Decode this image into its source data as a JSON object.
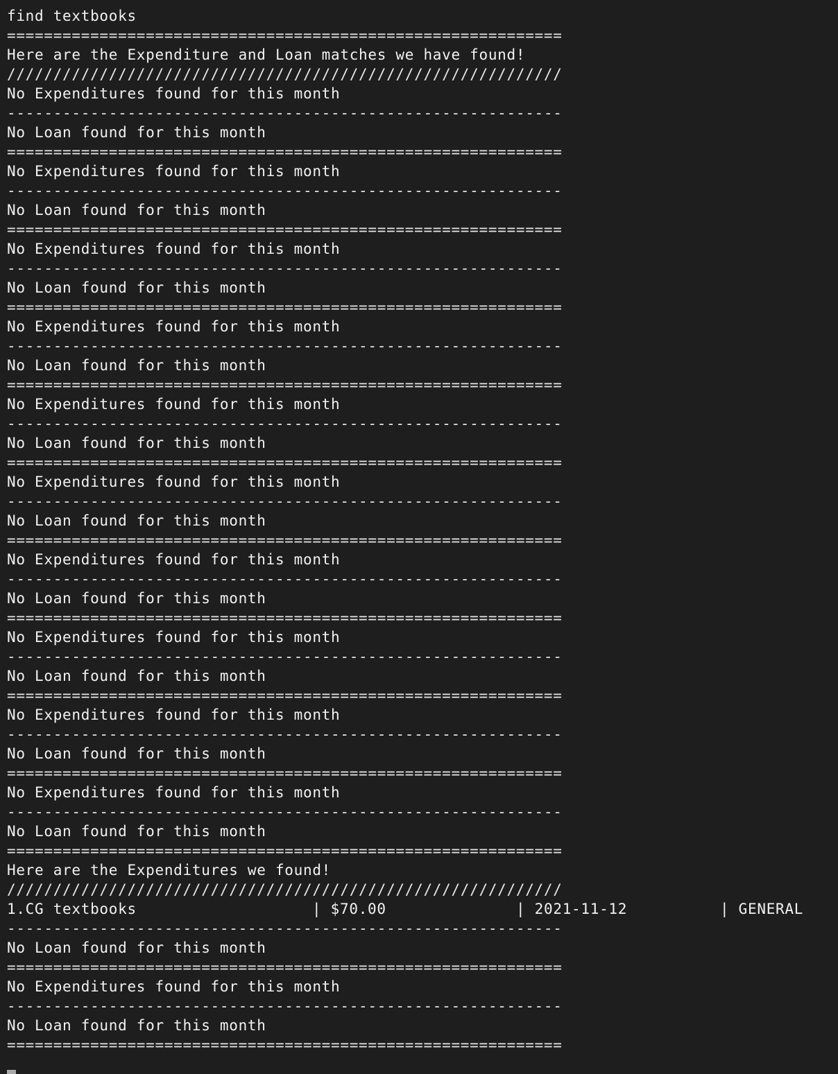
{
  "terminal": {
    "lines": [
      {
        "kind": "rule",
        "text": "============================================================"
      },
      {
        "kind": "text",
        "text": "find textbooks"
      },
      {
        "kind": "rule",
        "text": "============================================================"
      },
      {
        "kind": "text",
        "text": "Here are the Expenditure and Loan matches we have found!"
      },
      {
        "kind": "rule",
        "text": "////////////////////////////////////////////////////////////"
      },
      {
        "kind": "text",
        "text": "No Expenditures found for this month"
      },
      {
        "kind": "rule",
        "text": "------------------------------------------------------------"
      },
      {
        "kind": "text",
        "text": "No Loan found for this month"
      },
      {
        "kind": "rule",
        "text": "============================================================"
      },
      {
        "kind": "text",
        "text": "No Expenditures found for this month"
      },
      {
        "kind": "rule",
        "text": "------------------------------------------------------------"
      },
      {
        "kind": "text",
        "text": "No Loan found for this month"
      },
      {
        "kind": "rule",
        "text": "============================================================"
      },
      {
        "kind": "text",
        "text": "No Expenditures found for this month"
      },
      {
        "kind": "rule",
        "text": "------------------------------------------------------------"
      },
      {
        "kind": "text",
        "text": "No Loan found for this month"
      },
      {
        "kind": "rule",
        "text": "============================================================"
      },
      {
        "kind": "text",
        "text": "No Expenditures found for this month"
      },
      {
        "kind": "rule",
        "text": "------------------------------------------------------------"
      },
      {
        "kind": "text",
        "text": "No Loan found for this month"
      },
      {
        "kind": "rule",
        "text": "============================================================"
      },
      {
        "kind": "text",
        "text": "No Expenditures found for this month"
      },
      {
        "kind": "rule",
        "text": "------------------------------------------------------------"
      },
      {
        "kind": "text",
        "text": "No Loan found for this month"
      },
      {
        "kind": "rule",
        "text": "============================================================"
      },
      {
        "kind": "text",
        "text": "No Expenditures found for this month"
      },
      {
        "kind": "rule",
        "text": "------------------------------------------------------------"
      },
      {
        "kind": "text",
        "text": "No Loan found for this month"
      },
      {
        "kind": "rule",
        "text": "============================================================"
      },
      {
        "kind": "text",
        "text": "No Expenditures found for this month"
      },
      {
        "kind": "rule",
        "text": "------------------------------------------------------------"
      },
      {
        "kind": "text",
        "text": "No Loan found for this month"
      },
      {
        "kind": "rule",
        "text": "============================================================"
      },
      {
        "kind": "text",
        "text": "No Expenditures found for this month"
      },
      {
        "kind": "rule",
        "text": "------------------------------------------------------------"
      },
      {
        "kind": "text",
        "text": "No Loan found for this month"
      },
      {
        "kind": "rule",
        "text": "============================================================"
      },
      {
        "kind": "text",
        "text": "No Expenditures found for this month"
      },
      {
        "kind": "rule",
        "text": "------------------------------------------------------------"
      },
      {
        "kind": "text",
        "text": "No Loan found for this month"
      },
      {
        "kind": "rule",
        "text": "============================================================"
      },
      {
        "kind": "text",
        "text": "No Expenditures found for this month"
      },
      {
        "kind": "rule",
        "text": "------------------------------------------------------------"
      },
      {
        "kind": "text",
        "text": "No Loan found for this month"
      },
      {
        "kind": "rule",
        "text": "============================================================"
      },
      {
        "kind": "text",
        "text": "Here are the Expenditures we found!"
      },
      {
        "kind": "rule",
        "text": "////////////////////////////////////////////////////////////"
      },
      {
        "kind": "row",
        "cells": [
          "1.CG textbooks",
          "| $70.00",
          "| 2021-11-12",
          "| GENERAL"
        ]
      },
      {
        "kind": "rule",
        "text": "------------------------------------------------------------"
      },
      {
        "kind": "text",
        "text": "No Loan found for this month"
      },
      {
        "kind": "rule",
        "text": "============================================================"
      },
      {
        "kind": "text",
        "text": "No Expenditures found for this month"
      },
      {
        "kind": "rule",
        "text": "------------------------------------------------------------"
      },
      {
        "kind": "text",
        "text": "No Loan found for this month"
      },
      {
        "kind": "rule",
        "text": "============================================================"
      }
    ]
  },
  "colors": {
    "background": "#1e1e1e",
    "foreground": "#f2f2f2",
    "cursor": "#a9a9a9"
  }
}
